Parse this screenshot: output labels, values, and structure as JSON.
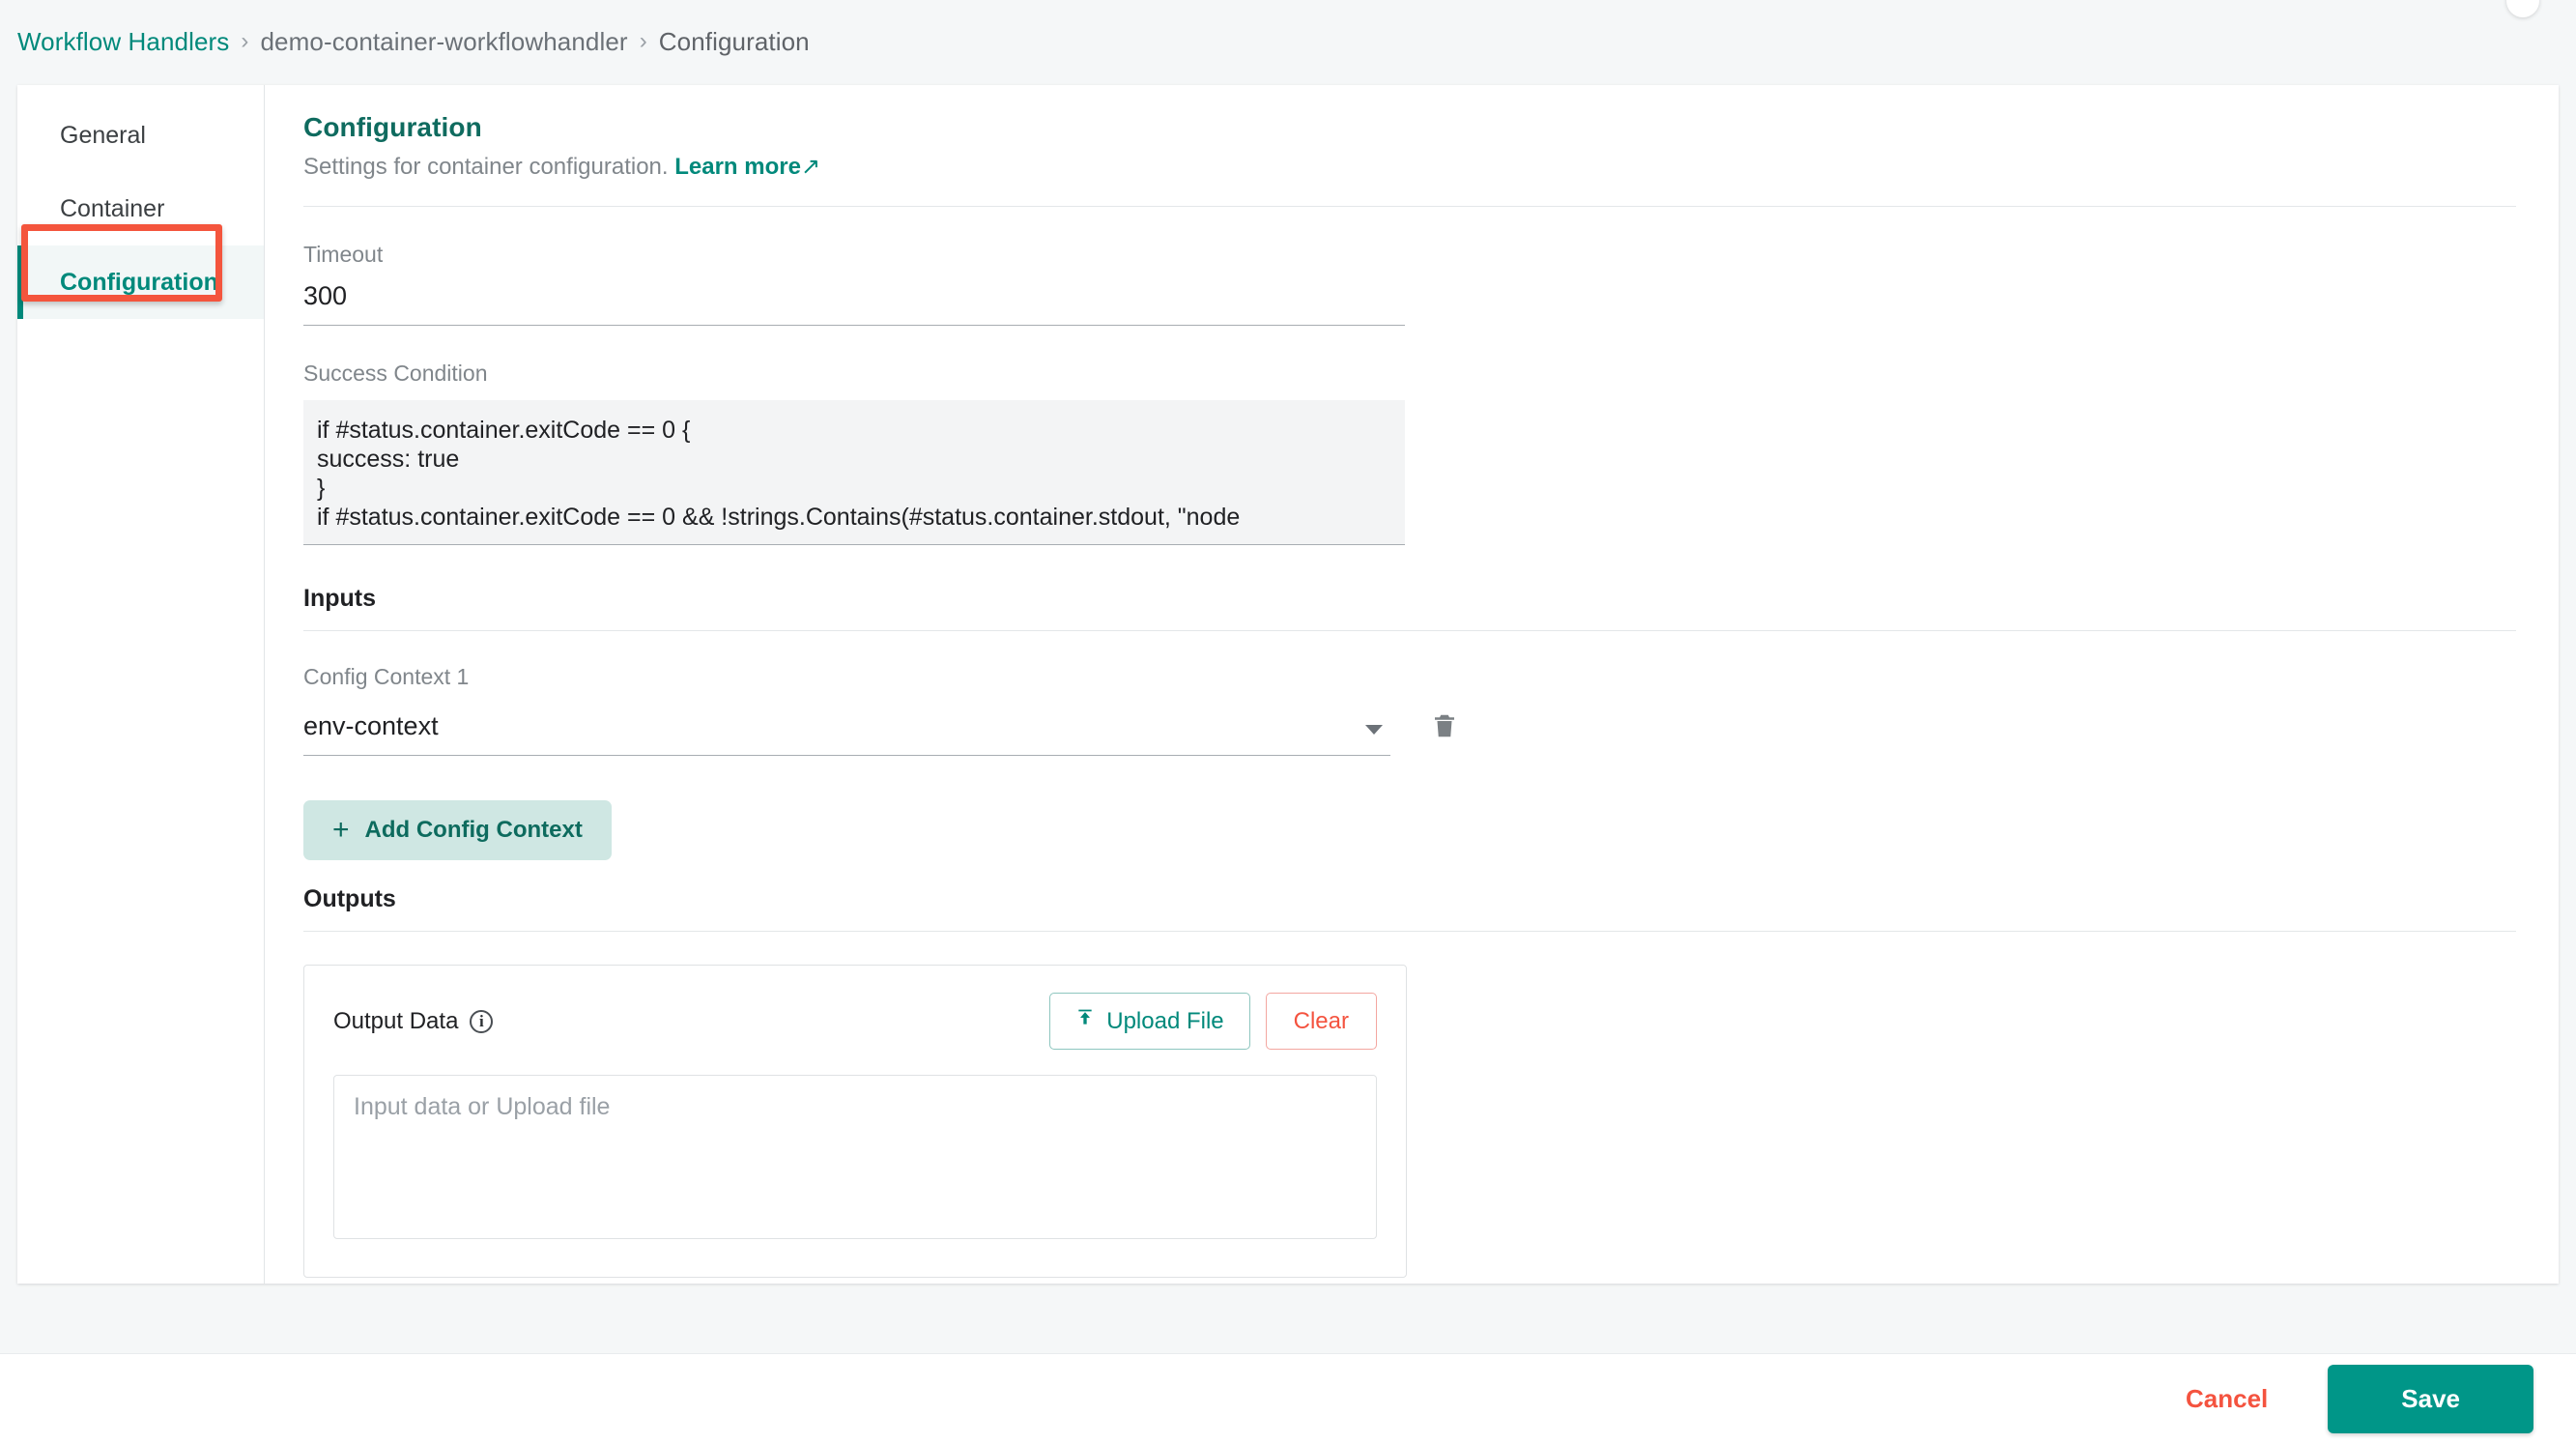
{
  "breadcrumb": {
    "root": "Workflow Handlers",
    "separator": "›",
    "middle": "demo-container-workflowhandler",
    "current": "Configuration"
  },
  "sidebar": {
    "items": [
      {
        "label": "General",
        "active": false
      },
      {
        "label": "Container",
        "active": false
      },
      {
        "label": "Configuration",
        "active": true
      }
    ]
  },
  "header": {
    "title": "Configuration",
    "description": "Settings for container configuration.",
    "learn_more": "Learn more",
    "learn_more_arrow": "↗"
  },
  "fields": {
    "timeout": {
      "label": "Timeout",
      "value": "300"
    },
    "success_condition": {
      "label": "Success Condition",
      "value": "if #status.container.exitCode == 0 {\nsuccess: true\n}\nif #status.container.exitCode == 0 && !strings.Contains(#status.container.stdout, \"node"
    }
  },
  "inputs": {
    "section_title": "Inputs",
    "config_context": {
      "label": "Config Context 1",
      "value": "env-context",
      "delete_icon": "trash-icon",
      "caret_icon": "chevron-down-icon"
    },
    "add_button": {
      "label": "Add Config Context",
      "icon": "plus-icon"
    }
  },
  "outputs": {
    "section_title": "Outputs",
    "output_data": {
      "label": "Output Data",
      "info_icon": "i",
      "upload_button": "Upload File",
      "upload_icon": "upload-icon",
      "clear_button": "Clear",
      "placeholder": "Input data or Upload file",
      "value": ""
    }
  },
  "footer": {
    "cancel": "Cancel",
    "save": "Save"
  },
  "colors": {
    "accent_teal": "#00897b",
    "save_teal": "#009688",
    "danger_red": "#f4533f",
    "annotation_red": "#f4553d",
    "add_button_bg": "#cfe7e3",
    "page_bg": "#f5f7f8"
  }
}
